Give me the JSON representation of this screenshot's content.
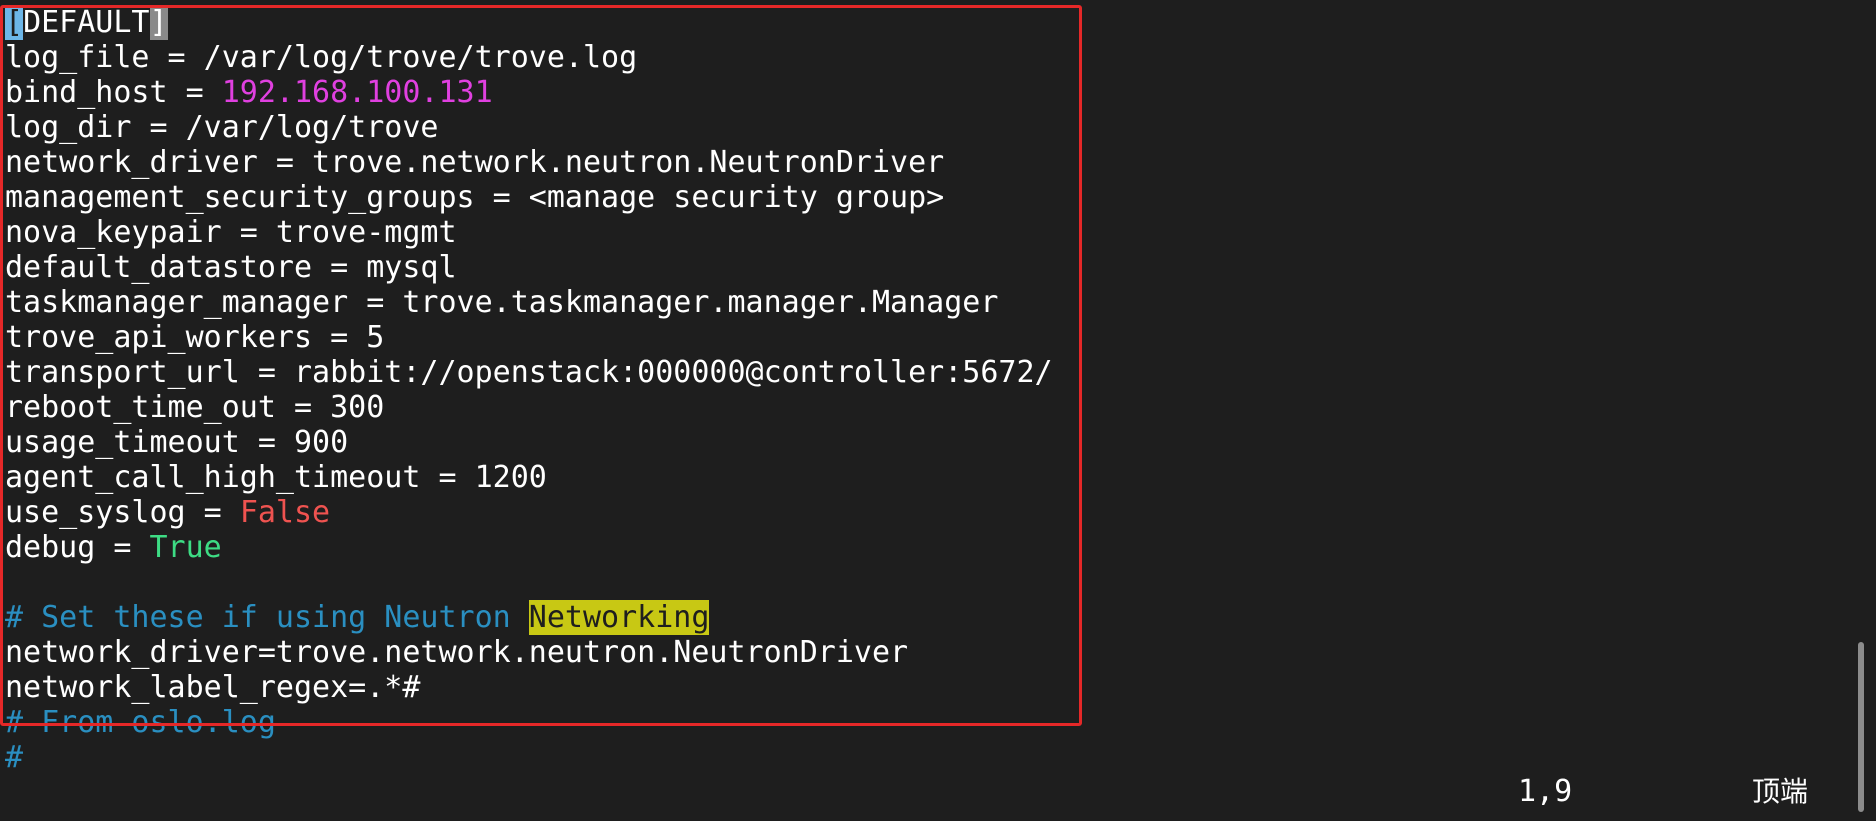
{
  "editor": {
    "lines": [
      {
        "parts": [
          {
            "t": "[",
            "s": "cursor"
          },
          {
            "t": "DEFAULT",
            "s": ""
          },
          {
            "t": "]",
            "s": "bracket-match"
          }
        ]
      },
      {
        "parts": [
          {
            "t": "log_file = /var/log/trove/trove.log",
            "s": ""
          }
        ]
      },
      {
        "parts": [
          {
            "t": "bind_host = ",
            "s": ""
          },
          {
            "t": "192.168.100.131",
            "s": "string-val"
          }
        ]
      },
      {
        "parts": [
          {
            "t": "log_dir = /var/log/trove",
            "s": ""
          }
        ]
      },
      {
        "parts": [
          {
            "t": "network_driver = trove.network.neutron.NeutronDriver",
            "s": ""
          }
        ]
      },
      {
        "parts": [
          {
            "t": "management_security_groups = <manage security group>",
            "s": ""
          }
        ]
      },
      {
        "parts": [
          {
            "t": "nova_keypair = trove-mgmt",
            "s": ""
          }
        ]
      },
      {
        "parts": [
          {
            "t": "default_datastore = mysql",
            "s": ""
          }
        ]
      },
      {
        "parts": [
          {
            "t": "taskmanager_manager = trove.taskmanager.manager.Manager",
            "s": ""
          }
        ]
      },
      {
        "parts": [
          {
            "t": "trove_api_workers = 5",
            "s": ""
          }
        ]
      },
      {
        "parts": [
          {
            "t": "transport_url = rabbit://openstack:000000@controller:5672/",
            "s": ""
          }
        ]
      },
      {
        "parts": [
          {
            "t": "reboot_time_out = 300",
            "s": ""
          }
        ]
      },
      {
        "parts": [
          {
            "t": "usage_timeout = 900",
            "s": ""
          }
        ]
      },
      {
        "parts": [
          {
            "t": "agent_call_high_timeout = 1200",
            "s": ""
          }
        ]
      },
      {
        "parts": [
          {
            "t": "use_syslog = ",
            "s": ""
          },
          {
            "t": "False",
            "s": "false-val"
          }
        ]
      },
      {
        "parts": [
          {
            "t": "debug = ",
            "s": ""
          },
          {
            "t": "True",
            "s": "true-val"
          }
        ]
      },
      {
        "parts": [
          {
            "t": "",
            "s": ""
          }
        ]
      },
      {
        "parts": [
          {
            "t": "# Set these if using Neutron ",
            "s": "comment"
          },
          {
            "t": "Networking",
            "s": "search-hl"
          }
        ]
      },
      {
        "parts": [
          {
            "t": "network_driver=trove.network.neutron.NeutronDriver",
            "s": ""
          }
        ]
      },
      {
        "parts": [
          {
            "t": "network_label_regex=.*#",
            "s": ""
          }
        ]
      },
      {
        "parts": [
          {
            "t": "# From oslo.log",
            "s": "comment"
          }
        ]
      },
      {
        "parts": [
          {
            "t": "#",
            "s": "comment"
          }
        ]
      }
    ]
  },
  "statusbar": {
    "position": "1,9",
    "scroll": "顶端"
  },
  "colors": {
    "background": "#1e1e1e",
    "annotation_box": "#e52828",
    "comment": "#2a8fc1",
    "ip_value": "#e040e0",
    "false_value": "#ef5350",
    "true_value": "#3ddc84",
    "search_highlight": "#c8c814"
  }
}
